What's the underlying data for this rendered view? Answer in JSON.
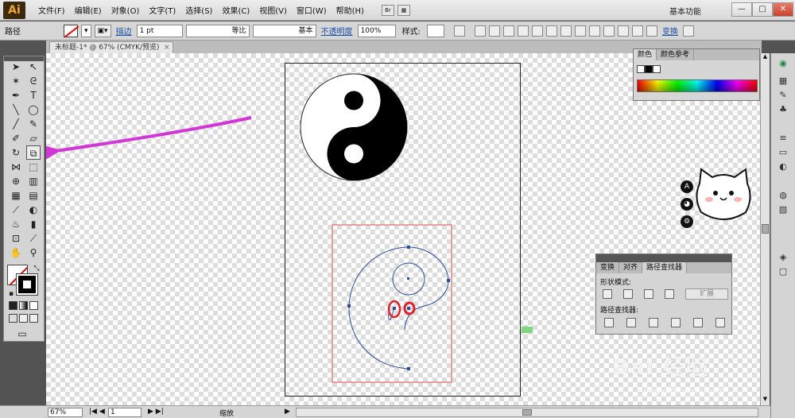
{
  "app": {
    "logo": "Ai"
  },
  "menu": [
    "文件(F)",
    "编辑(E)",
    "对象(O)",
    "文字(T)",
    "选择(S)",
    "效果(C)",
    "视图(V)",
    "窗口(W)",
    "帮助(H)"
  ],
  "menu_br_label": "Br",
  "workspace": "基本功能",
  "window_controls": {
    "min": "—",
    "max": "□",
    "close": "✕"
  },
  "control_bar": {
    "object_type": "路径",
    "stroke_link": "描边",
    "stroke_weight": "1 pt",
    "profile_label": "等比",
    "brush_label": "基本",
    "opacity_link": "不透明度",
    "opacity_value": "100%",
    "style_label": "样式:",
    "transform_link": "变换"
  },
  "document_tab": {
    "title": "未标题-1* @ 67% (CMYK/预览)",
    "close": "×"
  },
  "color_panel": {
    "tabs": [
      "颜色",
      "颜色参考"
    ]
  },
  "pathfinder_panel": {
    "tabs": [
      "变换",
      "对齐",
      "路径查找器"
    ],
    "shape_modes_label": "形状模式:",
    "pathfinders_label": "路径查找器:",
    "expand_label": "扩展"
  },
  "status_bar": {
    "zoom": "67%",
    "page": "1",
    "tool_name": "缩放"
  },
  "watermark": {
    "text": "Bai 经验",
    "url": "jingyan.baidu.com"
  },
  "colors": {
    "arrow": "#d336d6",
    "selection": "#e05050",
    "path": "#2a4f9c",
    "highlight": "#e0202a"
  }
}
